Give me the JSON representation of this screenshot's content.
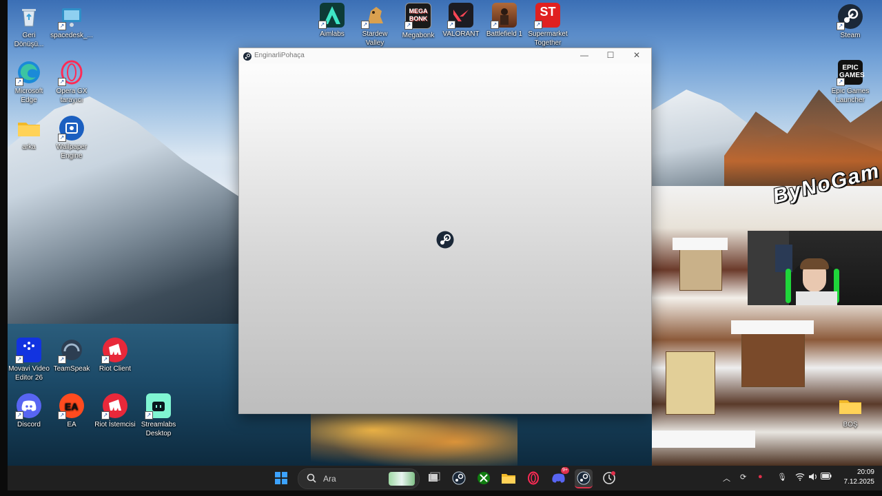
{
  "desktop": {
    "icons_left": [
      {
        "label": "Geri Dönüşü...",
        "icon": "recycle-bin-icon"
      },
      {
        "label": "spacedesk_...",
        "icon": "spacedesk-icon"
      },
      {
        "label": "Microsoft Edge",
        "icon": "edge-icon"
      },
      {
        "label": "Opera GX tarayıcı",
        "icon": "opera-gx-icon"
      },
      {
        "label": "arka",
        "icon": "folder-icon"
      },
      {
        "label": "Wallpaper Engine",
        "icon": "wallpaper-engine-icon"
      },
      {
        "label": "Movavi Video Editor 26",
        "icon": "movavi-icon"
      },
      {
        "label": "TeamSpeak",
        "icon": "teamspeak-icon"
      },
      {
        "label": "Riot Client",
        "icon": "riot-client-icon"
      },
      {
        "label": "Discord",
        "icon": "discord-icon"
      },
      {
        "label": "EA",
        "icon": "ea-icon"
      },
      {
        "label": "Riot İstemcisi",
        "icon": "riot-istemcisi-icon"
      },
      {
        "label": "Streamlabs Desktop",
        "icon": "streamlabs-icon"
      }
    ],
    "icons_top": [
      {
        "label": "Aimlabs",
        "icon": "aimlabs-icon"
      },
      {
        "label": "Stardew Valley",
        "icon": "stardew-icon"
      },
      {
        "label": "Megabonk",
        "icon": "megabonk-icon",
        "art": "MEGA BONK"
      },
      {
        "label": "VALORANT",
        "icon": "valorant-icon"
      },
      {
        "label": "Battlefield 1",
        "icon": "battlefield-icon"
      },
      {
        "label": "Supermarket Together",
        "icon": "supermarket-icon",
        "art": "ST"
      }
    ],
    "icons_right": [
      {
        "label": "Steam",
        "icon": "steam-icon"
      },
      {
        "label": "Epic Games Launcher",
        "icon": "epic-icon",
        "art": "EPIC GAMES"
      },
      {
        "label": "BOŞ",
        "icon": "folder-icon"
      }
    ]
  },
  "window": {
    "title": "EnginarliPohaça",
    "minimize": "—",
    "maximize": "☐",
    "close": "✕"
  },
  "overlay": {
    "brand": "ByNoGam"
  },
  "taskbar": {
    "search_placeholder": "Ara",
    "time": "20:09",
    "date": "7.12.2025",
    "discord_badge": "9+"
  }
}
